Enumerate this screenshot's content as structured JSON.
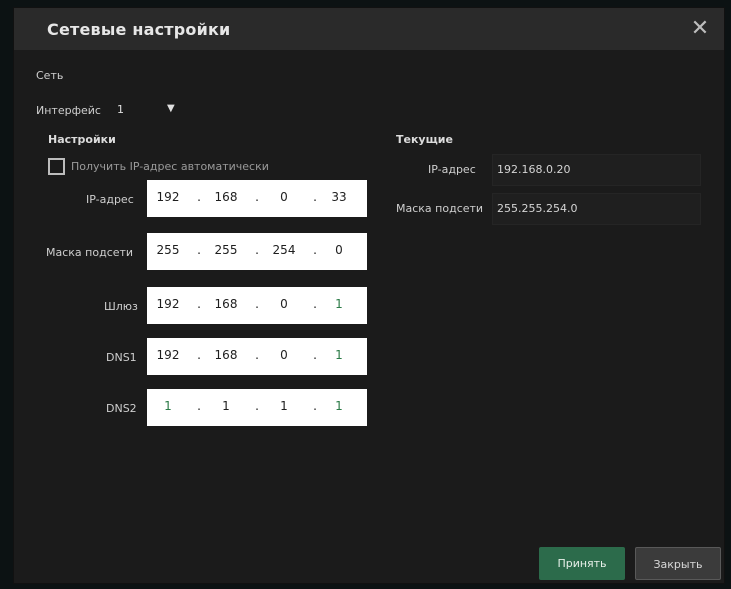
{
  "dialog": {
    "title": "Сетевые настройки",
    "close_glyph": "✕"
  },
  "network_section": "Сеть",
  "interface": {
    "label": "Интерфейс",
    "value": "1",
    "arrow": "▼"
  },
  "settings": {
    "heading": "Настройки",
    "auto_ip_label": "Получить IP-адрес автоматически",
    "auto_ip_checked": false,
    "fields": [
      {
        "label": "IP-адрес",
        "octets": [
          "192",
          "168",
          "0",
          "33"
        ]
      },
      {
        "label": "Маска подсети",
        "octets": [
          "255",
          "255",
          "254",
          "0"
        ]
      },
      {
        "label": "Шлюз",
        "octets": [
          "192",
          "168",
          "0",
          "1"
        ]
      },
      {
        "label": "DNS1",
        "octets": [
          "192",
          "168",
          "0",
          "1"
        ]
      },
      {
        "label": "DNS2",
        "octets": [
          "1",
          "1",
          "1",
          "1"
        ]
      }
    ]
  },
  "current": {
    "heading": "Текущие",
    "ip_label": "IP-адрес",
    "ip_value": "192.168.0.20",
    "mask_label": "Маска подсети",
    "mask_value": "255.255.254.0"
  },
  "buttons": {
    "apply": "Принять",
    "close": "Закрыть"
  },
  "colors": {
    "apply_button": "#2c6b4b",
    "window_bg": "#1b1b1b",
    "titlebar_bg": "#2a2a2a"
  }
}
